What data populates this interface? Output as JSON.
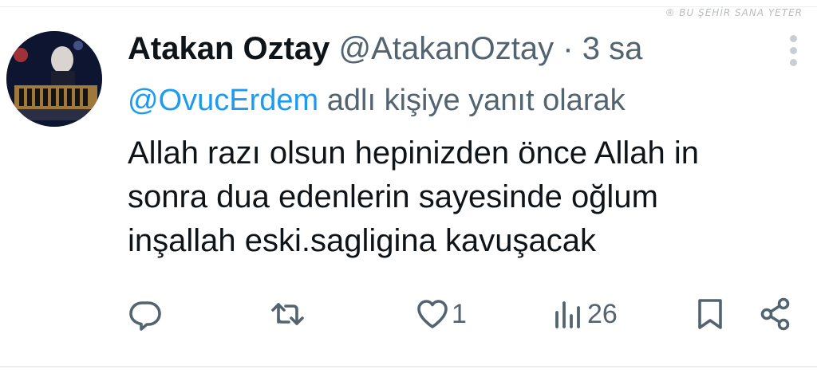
{
  "watermark": "® BU ŞEHİR SANA YETER",
  "tweet": {
    "author_name": "Atakan Oztay",
    "author_handle": "@AtakanOztay",
    "separator": "·",
    "time": "3 sa",
    "reply_to": {
      "mention": "@OvucErdem",
      "suffix": " adlı kişiye yanıt olarak"
    },
    "text_lines": [
      "Allah razı olsun hepinizden önce Allah in",
      "sonra dua edenlerin sayesinde oğlum",
      "inşallah eski.sagligina kavuşacak"
    ]
  },
  "actions": {
    "reply": {
      "icon": "reply-icon"
    },
    "retweet": {
      "icon": "retweet-icon"
    },
    "like": {
      "icon": "heart-icon",
      "count": "1"
    },
    "views": {
      "icon": "views-icon",
      "count": "26"
    },
    "bookmark": {
      "icon": "bookmark-icon"
    },
    "share": {
      "icon": "share-icon"
    }
  },
  "colors": {
    "text": "#0f1419",
    "secondary": "#536471",
    "link": "#1d9bf0",
    "divider": "#eceef0"
  }
}
